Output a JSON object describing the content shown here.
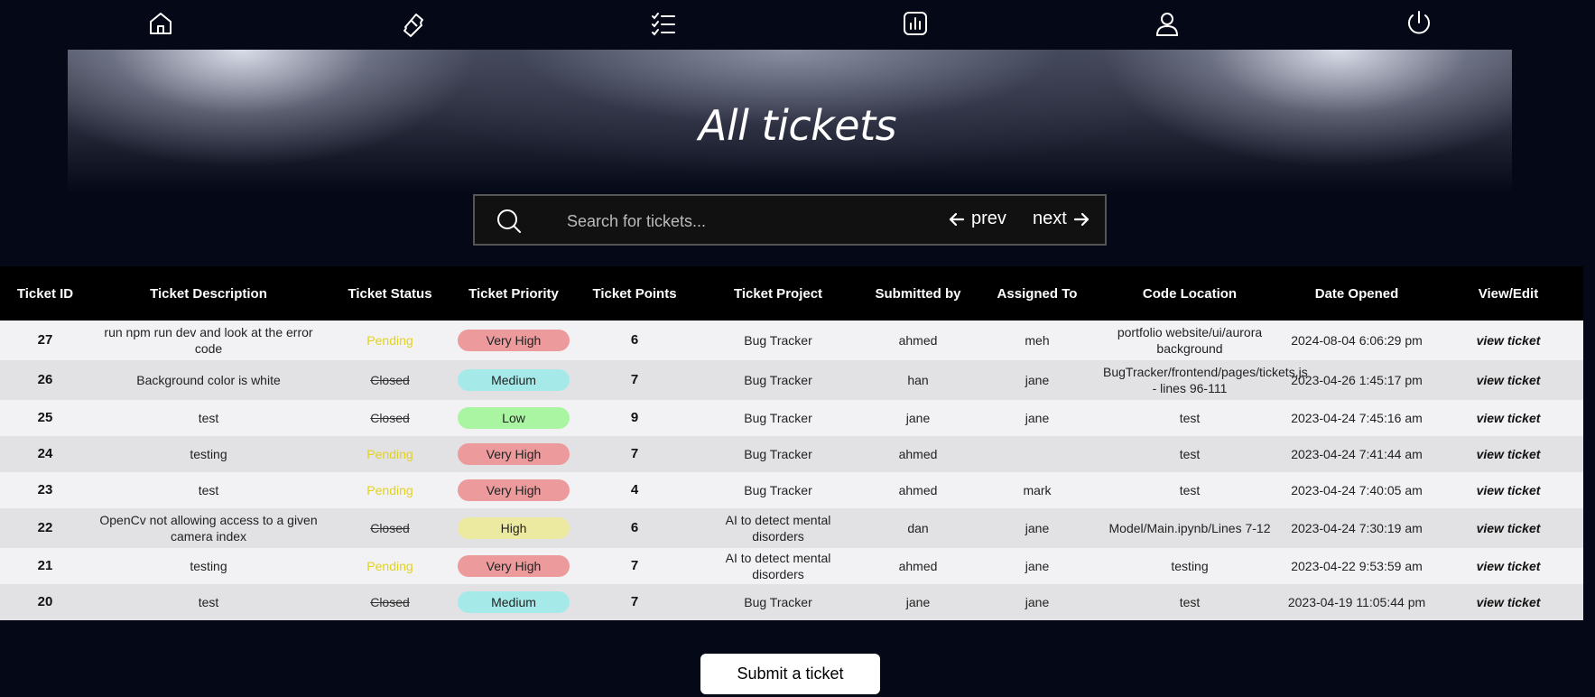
{
  "nav": {
    "icons": [
      "home-icon",
      "ticket-icon",
      "checklist-icon",
      "chart-icon",
      "user-icon",
      "power-icon"
    ]
  },
  "page": {
    "title": "All tickets"
  },
  "search": {
    "placeholder": "Search for tickets...",
    "value": "",
    "prev_label": "prev",
    "next_label": "next"
  },
  "table": {
    "headers": [
      "Ticket ID",
      "Ticket Description",
      "Ticket Status",
      "Ticket Priority",
      "Ticket Points",
      "Ticket Project",
      "Submitted by",
      "Assigned To",
      "Code Location",
      "Date Opened",
      "View/Edit"
    ],
    "rows": [
      {
        "id": "27",
        "description": "run npm run dev and look at the error code",
        "status": "Pending",
        "priority": "Very High",
        "points": "6",
        "project": "Bug Tracker",
        "submitted_by": "ahmed",
        "assigned_to": "meh",
        "code_location": "portfolio website/ui/aurora background",
        "date_opened": "2024-08-04 6:06:29 pm",
        "view": "view ticket"
      },
      {
        "id": "26",
        "description": "Background color is white",
        "status": "Closed",
        "priority": "Medium",
        "points": "7",
        "project": "Bug Tracker",
        "submitted_by": "han",
        "assigned_to": "jane",
        "code_location": "BugTracker/frontend/pages/tickets.js - lines 96-111",
        "date_opened": "2023-04-26 1:45:17 pm",
        "view": "view ticket"
      },
      {
        "id": "25",
        "description": "test",
        "status": "Closed",
        "priority": "Low",
        "points": "9",
        "project": "Bug Tracker",
        "submitted_by": "jane",
        "assigned_to": "jane",
        "code_location": "test",
        "date_opened": "2023-04-24 7:45:16 am",
        "view": "view ticket"
      },
      {
        "id": "24",
        "description": "testing",
        "status": "Pending",
        "priority": "Very High",
        "points": "7",
        "project": "Bug Tracker",
        "submitted_by": "ahmed",
        "assigned_to": "",
        "code_location": "test",
        "date_opened": "2023-04-24 7:41:44 am",
        "view": "view ticket"
      },
      {
        "id": "23",
        "description": "test",
        "status": "Pending",
        "priority": "Very High",
        "points": "4",
        "project": "Bug Tracker",
        "submitted_by": "ahmed",
        "assigned_to": "mark",
        "code_location": "test",
        "date_opened": "2023-04-24 7:40:05 am",
        "view": "view ticket"
      },
      {
        "id": "22",
        "description": "OpenCv not allowing access to a given camera index",
        "status": "Closed",
        "priority": "High",
        "points": "6",
        "project": "AI to detect mental disorders",
        "submitted_by": "dan",
        "assigned_to": "jane",
        "code_location": "Model/Main.ipynb/Lines 7-12",
        "date_opened": "2023-04-24 7:30:19 am",
        "view": "view ticket"
      },
      {
        "id": "21",
        "description": "testing",
        "status": "Pending",
        "priority": "Very High",
        "points": "7",
        "project": "AI to detect mental disorders",
        "submitted_by": "ahmed",
        "assigned_to": "jane",
        "code_location": "testing",
        "date_opened": "2023-04-22 9:53:59 am",
        "view": "view ticket"
      },
      {
        "id": "20",
        "description": "test",
        "status": "Closed",
        "priority": "Medium",
        "points": "7",
        "project": "Bug Tracker",
        "submitted_by": "jane",
        "assigned_to": "jane",
        "code_location": "test",
        "date_opened": "2023-04-19 11:05:44 pm",
        "view": "view ticket"
      }
    ]
  },
  "priority_colors": {
    "Very High": "#ec9a9c",
    "Medium": "#a6e9e9",
    "Low": "#a9f5a2",
    "High": "#ece9a0"
  },
  "status_colors": {
    "Pending": "#e3d21b",
    "Closed": "#333333"
  },
  "submit_label": "Submit a ticket"
}
